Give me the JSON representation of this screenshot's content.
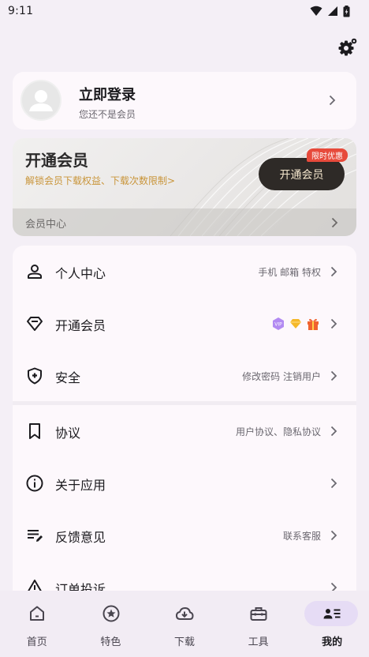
{
  "status_bar": {
    "time": "9:11"
  },
  "account": {
    "title": "立即登录",
    "subtitle": "您还不是会员"
  },
  "vip": {
    "title": "开通会员",
    "desc": "解锁会员下载权益、下载次数限制>",
    "button": "开通会员",
    "tag": "限时优惠",
    "center": "会员中心"
  },
  "menu": [
    {
      "label": "个人中心",
      "extra": "手机 邮箱 特权",
      "icon": "person-icon"
    },
    {
      "label": "开通会员",
      "extra": "",
      "icon": "diamond-icon"
    },
    {
      "label": "安全",
      "extra": "修改密码  注销用户",
      "icon": "shield-icon"
    },
    {
      "label": "协议",
      "extra": "用户协议、隐私协议",
      "icon": "bookmark-icon"
    },
    {
      "label": "关于应用",
      "extra": "",
      "icon": "info-icon"
    },
    {
      "label": "反馈意见",
      "extra": "联系客服",
      "icon": "feedback-icon"
    },
    {
      "label": "订单投诉",
      "extra": "",
      "icon": "warning-icon"
    }
  ],
  "badges": {
    "vip_text": "VIP"
  },
  "nav": [
    {
      "label": "首页",
      "icon": "home-icon"
    },
    {
      "label": "特色",
      "icon": "star-icon"
    },
    {
      "label": "下载",
      "icon": "cloud-download-icon"
    },
    {
      "label": "工具",
      "icon": "toolbox-icon"
    },
    {
      "label": "我的",
      "icon": "profile-list-icon",
      "active": true
    }
  ]
}
